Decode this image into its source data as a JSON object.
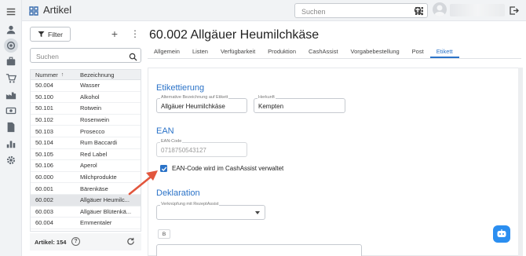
{
  "app": {
    "title": "Artikel"
  },
  "topbar": {
    "search_placeholder": "Suchen",
    "icons": [
      "menu-icon",
      "logo-icon",
      "search-icon",
      "apps-grid-icon",
      "avatar",
      "logout-icon"
    ]
  },
  "rail": {
    "icons": [
      "menu-icon",
      "person-icon",
      "settings-circle-icon",
      "briefcase-icon",
      "cart-icon",
      "factory-icon",
      "cash-icon",
      "document-icon",
      "chart-icon",
      "gear-icon"
    ]
  },
  "left_panel": {
    "filter_label": "Filter",
    "search_placeholder": "Suchen",
    "columns": {
      "number": "Nummer",
      "name": "Bezeichnung"
    },
    "rows": [
      {
        "number": "50.004",
        "name": "Wasser"
      },
      {
        "number": "50.100",
        "name": "Alkohol"
      },
      {
        "number": "50.101",
        "name": "Rotwein"
      },
      {
        "number": "50.102",
        "name": "Rosenwein"
      },
      {
        "number": "50.103",
        "name": "Prosecco"
      },
      {
        "number": "50.104",
        "name": "Rum Baccardi"
      },
      {
        "number": "50.105",
        "name": "Red Label"
      },
      {
        "number": "50.106",
        "name": "Aperol"
      },
      {
        "number": "60.000",
        "name": "Milchprodukte"
      },
      {
        "number": "60.001",
        "name": "Bärenkäse"
      },
      {
        "number": "60.002",
        "name": "Allgäuer Heumilc..."
      },
      {
        "number": "60.003",
        "name": "Allgäuer Blütenkä..."
      },
      {
        "number": "60.004",
        "name": "Emmentaler"
      }
    ],
    "selected_index": 10,
    "footer": {
      "count_label": "Artikel: 154"
    }
  },
  "main": {
    "title": "60.002 Allgäuer Heumilchkäse",
    "tabs": [
      "Allgemein",
      "Listen",
      "Verfügbarkeit",
      "Produktion",
      "CashAssist",
      "Vorgabebestellung",
      "Post",
      "Etikett"
    ],
    "active_tab": "Etikett",
    "etikettierung": {
      "title": "Etikettierung",
      "alt_label": "Alternative Bezeichnung auf Etikett",
      "alt_value": "Allgäuer Heumilchkäse",
      "origin_label": "Herkunft",
      "origin_value": "Kempten"
    },
    "ean": {
      "title": "EAN",
      "code_label": "EAN-Code",
      "code_value": "0718750543127",
      "checkbox_label": "EAN-Code wird im CashAssist verwaltet",
      "checkbox_checked": true
    },
    "deklaration": {
      "title": "Deklaration",
      "select_label": "Verknüpfung mit RezeptAssist",
      "select_value": "",
      "bold_label": "B"
    }
  },
  "colors": {
    "accent": "#2b73c8",
    "arrow": "#e2563d",
    "chat": "#2b8ef0"
  }
}
